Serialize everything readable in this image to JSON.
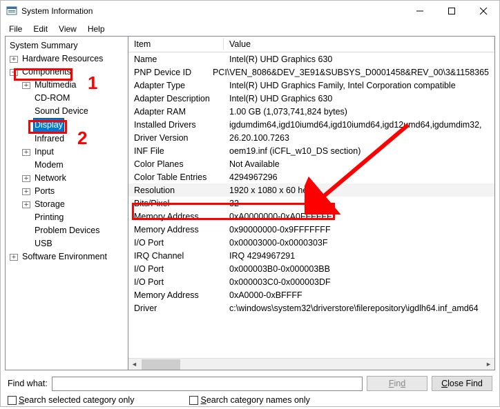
{
  "window": {
    "title": "System Information"
  },
  "menubar": {
    "file": "File",
    "edit": "Edit",
    "view": "View",
    "help": "Help"
  },
  "tree": {
    "summary": "System Summary",
    "hardware": "Hardware Resources",
    "components": "Components",
    "multimedia": "Multimedia",
    "cdrom": "CD-ROM",
    "sound": "Sound Device",
    "display": "Display",
    "infrared": "Infrared",
    "input": "Input",
    "modem": "Modem",
    "network": "Network",
    "ports": "Ports",
    "storage": "Storage",
    "printing": "Printing",
    "problem": "Problem Devices",
    "usb": "USB",
    "software": "Software Environment"
  },
  "grid": {
    "header_item": "Item",
    "header_value": "Value",
    "rows": [
      {
        "item": "Name",
        "value": "Intel(R) UHD Graphics 630"
      },
      {
        "item": "PNP Device ID",
        "value": "PCI\\VEN_8086&DEV_3E91&SUBSYS_D0001458&REV_00\\3&1158365"
      },
      {
        "item": "Adapter Type",
        "value": "Intel(R) UHD Graphics Family, Intel Corporation compatible"
      },
      {
        "item": "Adapter Description",
        "value": "Intel(R) UHD Graphics 630"
      },
      {
        "item": "Adapter RAM",
        "value": "1.00 GB (1,073,741,824 bytes)"
      },
      {
        "item": "Installed Drivers",
        "value": "igdumdim64,igd10iumd64,igd10iumd64,igd12umd64,igdumdim32,"
      },
      {
        "item": "Driver Version",
        "value": "26.20.100.7263"
      },
      {
        "item": "INF File",
        "value": "oem19.inf (iCFL_w10_DS section)"
      },
      {
        "item": "Color Planes",
        "value": "Not Available"
      },
      {
        "item": "Color Table Entries",
        "value": "4294967296"
      },
      {
        "item": "Resolution",
        "value": "1920 x 1080 x 60 hertz"
      },
      {
        "item": "Bits/Pixel",
        "value": "32"
      },
      {
        "item": "Memory Address",
        "value": "0xA0000000-0xA0FFFFFF"
      },
      {
        "item": "Memory Address",
        "value": "0x90000000-0x9FFFFFFF"
      },
      {
        "item": "I/O Port",
        "value": "0x00003000-0x0000303F"
      },
      {
        "item": "IRQ Channel",
        "value": "IRQ 4294967291"
      },
      {
        "item": "I/O Port",
        "value": "0x000003B0-0x000003BB"
      },
      {
        "item": "I/O Port",
        "value": "0x000003C0-0x000003DF"
      },
      {
        "item": "Memory Address",
        "value": "0xA0000-0xBFFFF"
      },
      {
        "item": "Driver",
        "value": "c:\\windows\\system32\\driverstore\\filerepository\\igdlh64.inf_amd64"
      }
    ]
  },
  "bottom": {
    "find_label": "Find what:",
    "find_btn": "Find",
    "close_btn": "Close Find",
    "check1_pre": "S",
    "check1_rest": "earch selected category only",
    "check2_pre": "S",
    "check2_rest": "earch category names only"
  },
  "annotations": {
    "num1": "1",
    "num2": "2"
  }
}
